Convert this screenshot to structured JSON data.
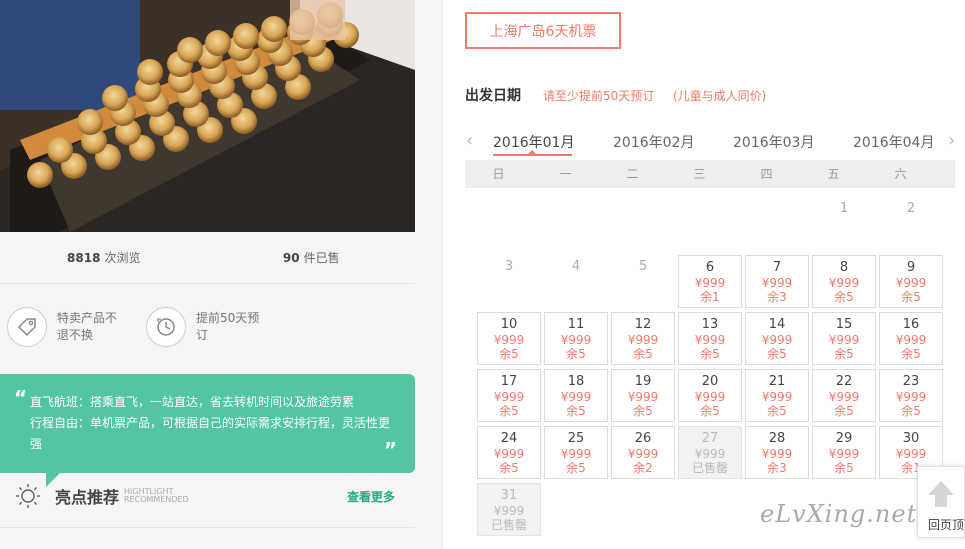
{
  "product_tag": "上海广岛6天机票",
  "stats": {
    "views_count": "8818",
    "views_label": "次浏览",
    "sold_count": "90",
    "sold_label": "件已售"
  },
  "features": [
    {
      "icon": "tag-icon",
      "text": "特卖产品不退不换"
    },
    {
      "icon": "clock-icon",
      "text": "提前50天预订"
    }
  ],
  "quote": {
    "line1": "直飞航班：搭乘直飞，一站直达，省去转机时间以及旅途劳累",
    "line2": "行程自由：单机票产品，可根据自己的实际需求安排行程，灵活性更强"
  },
  "highlight": {
    "title": "亮点推荐",
    "en_line1": "HIGHTLIGHT",
    "en_line2": "RECOMMENDED",
    "more": "查看更多"
  },
  "departure": {
    "title": "出发日期",
    "note_advance": "请至少提前50天预订",
    "note_child": "(儿童与成人同价)"
  },
  "months": [
    "2016年01月",
    "2016年02月",
    "2016年03月",
    "2016年04月"
  ],
  "active_month": "2016年01月",
  "weekdays": [
    "日",
    "一",
    "二",
    "三",
    "四",
    "五",
    "六"
  ],
  "calendar": {
    "empty_days": [
      "1",
      "2",
      "3",
      "4",
      "5"
    ],
    "days": [
      {
        "day": "6",
        "price": "¥999",
        "remain": "余1"
      },
      {
        "day": "7",
        "price": "¥999",
        "remain": "余3"
      },
      {
        "day": "8",
        "price": "¥999",
        "remain": "余5"
      },
      {
        "day": "9",
        "price": "¥999",
        "remain": "余5"
      },
      {
        "day": "10",
        "price": "¥999",
        "remain": "余5"
      },
      {
        "day": "11",
        "price": "¥999",
        "remain": "余5"
      },
      {
        "day": "12",
        "price": "¥999",
        "remain": "余5"
      },
      {
        "day": "13",
        "price": "¥999",
        "remain": "余5"
      },
      {
        "day": "14",
        "price": "¥999",
        "remain": "余5"
      },
      {
        "day": "15",
        "price": "¥999",
        "remain": "余5"
      },
      {
        "day": "16",
        "price": "¥999",
        "remain": "余5"
      },
      {
        "day": "17",
        "price": "¥999",
        "remain": "余5"
      },
      {
        "day": "18",
        "price": "¥999",
        "remain": "余5"
      },
      {
        "day": "19",
        "price": "¥999",
        "remain": "余5"
      },
      {
        "day": "20",
        "price": "¥999",
        "remain": "余5"
      },
      {
        "day": "21",
        "price": "¥999",
        "remain": "余5"
      },
      {
        "day": "22",
        "price": "¥999",
        "remain": "余5"
      },
      {
        "day": "23",
        "price": "¥999",
        "remain": "余5"
      },
      {
        "day": "24",
        "price": "¥999",
        "remain": "余5"
      },
      {
        "day": "25",
        "price": "¥999",
        "remain": "余5"
      },
      {
        "day": "26",
        "price": "¥999",
        "remain": "余2"
      },
      {
        "day": "27",
        "price": "¥999",
        "remain": "已售罄",
        "soldout": true
      },
      {
        "day": "28",
        "price": "¥999",
        "remain": "余3"
      },
      {
        "day": "29",
        "price": "¥999",
        "remain": "余5"
      },
      {
        "day": "30",
        "price": "¥999",
        "remain": "余1"
      },
      {
        "day": "31",
        "price": "¥999",
        "remain": "已售罄",
        "soldout": true
      }
    ]
  },
  "back_to_top": "回页顶",
  "watermark": "eLvXing.net",
  "colors": {
    "accent": "#f07b6c",
    "green": "#53c4a4",
    "link_green": "#2aa880"
  }
}
